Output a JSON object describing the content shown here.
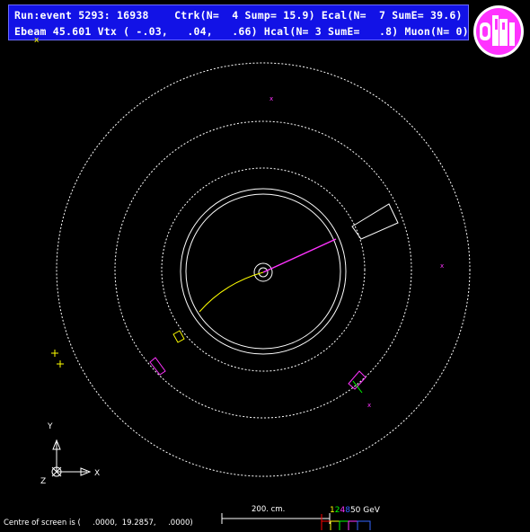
{
  "header": {
    "line1": "Run:event 5293: 16938    Ctrk(N=  4 Sump= 15.9) Ecal(N=  7 SumE= 39.6)",
    "line2": "Ebeam 45.601 Vtx ( -.03,   .04,   .66) Hcal(N= 3 SumE=   .8) Muon(N= 0)"
  },
  "logo": {
    "text": "OPAL",
    "ring_color": "#ff33ff",
    "inner_color": "#ffffff"
  },
  "axes": {
    "y": "Y",
    "x": "X",
    "z": "Z"
  },
  "scale_bar": {
    "label": "200. cm."
  },
  "energy_legend": {
    "labels": [
      "1",
      "2",
      "4",
      "8",
      "50 GeV"
    ],
    "colors": [
      "#ffff00",
      "#00ff00",
      "#ff33ff",
      "#3366ff",
      "#ffffff"
    ]
  },
  "footer": {
    "coord_text": "Centre of screen is (     .0000,  19.2857,     .0000)"
  },
  "colors": {
    "track": "#ffff00",
    "ecal": "#ff33ff",
    "hcal": "#ffffff",
    "muon": "#ff33ff"
  }
}
